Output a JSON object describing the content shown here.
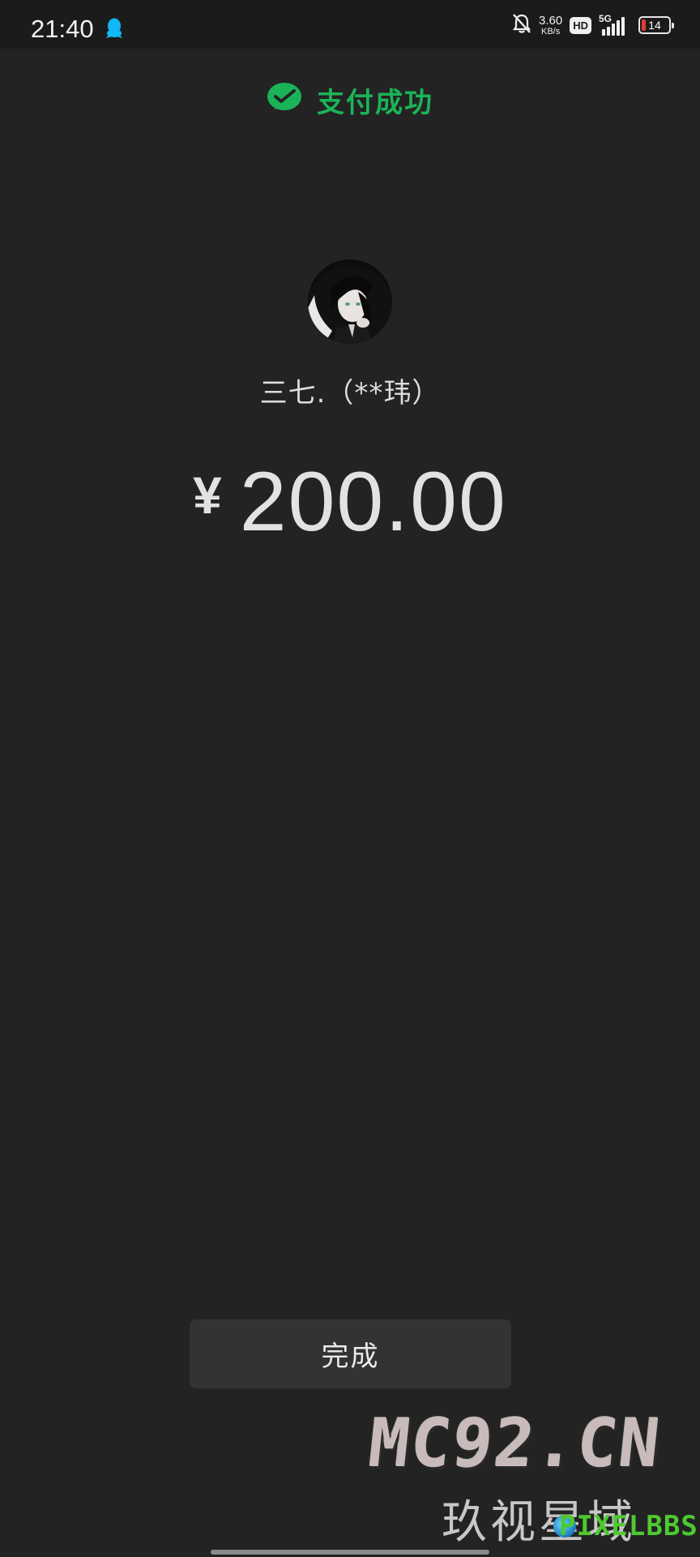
{
  "status_bar": {
    "time": "21:40",
    "speed_value": "3.60",
    "speed_unit": "KB/s",
    "hd_label": "HD",
    "network_label": "5G",
    "battery_level": "14",
    "icons": [
      "qq-icon",
      "bell-off-icon",
      "signal-icon",
      "battery-icon"
    ],
    "battery_color": "#e53935"
  },
  "header": {
    "title": "支付成功",
    "icon": "wechat-pay-icon",
    "accent_color": "#1bb357"
  },
  "payee": {
    "name": "三七.（**玮）",
    "avatar": "avatar"
  },
  "amount": {
    "currency": "¥",
    "value": "200.00"
  },
  "actions": {
    "done_label": "完成"
  },
  "watermark": {
    "main": "MC92.CN",
    "sub": "玖视星域",
    "logo": "PIXELBBS"
  }
}
